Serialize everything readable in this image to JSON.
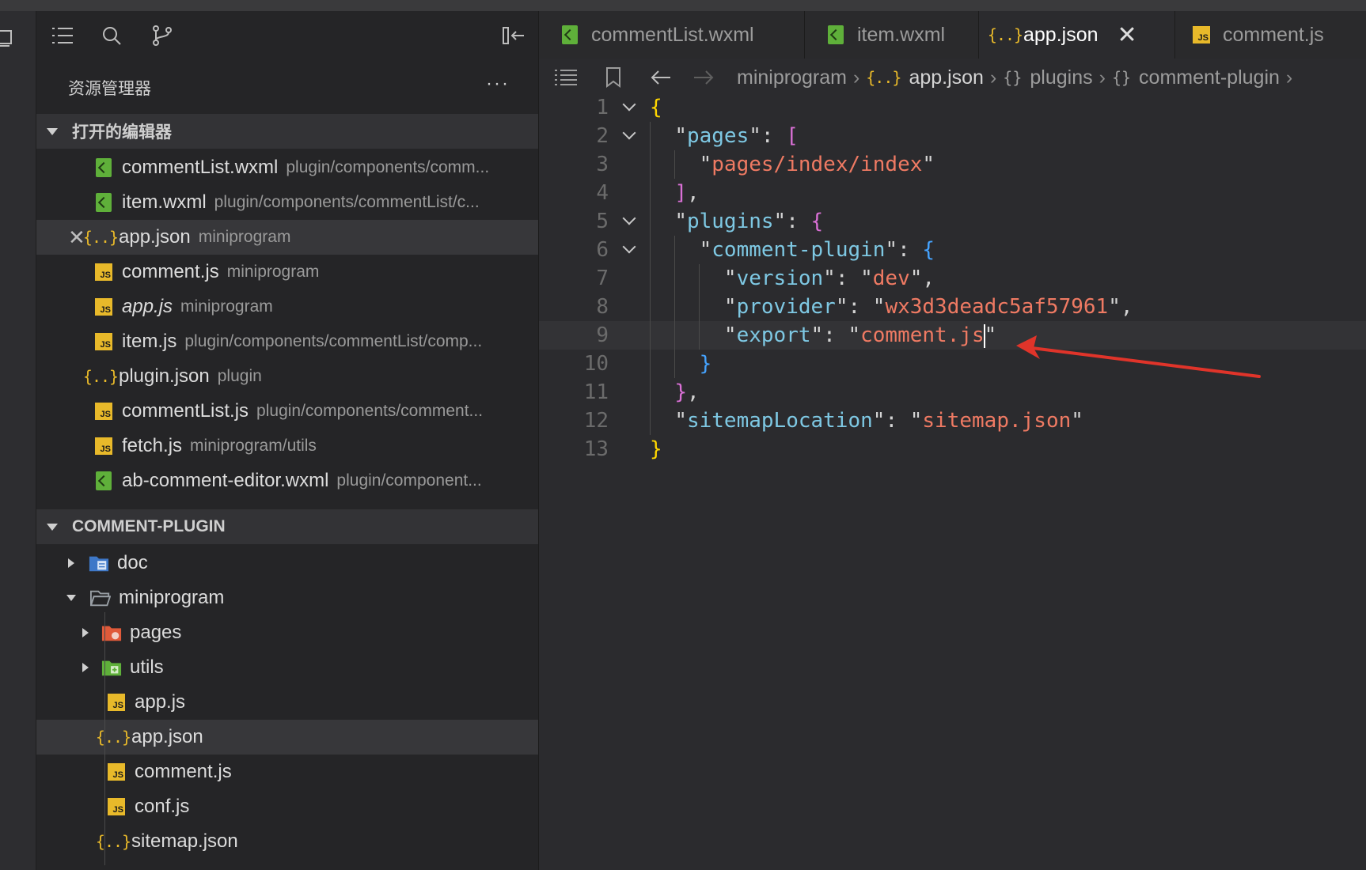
{
  "sidebar": {
    "title": "资源管理器",
    "more": "···",
    "open_editors": {
      "title": "打开的编辑器",
      "items": [
        {
          "name": "commentList.wxml",
          "path": "plugin/components/comm...",
          "icon": "wxml"
        },
        {
          "name": "item.wxml",
          "path": "plugin/components/commentList/c...",
          "icon": "wxml"
        },
        {
          "name": "app.json",
          "path": "miniprogram",
          "icon": "json"
        },
        {
          "name": "comment.js",
          "path": "miniprogram",
          "icon": "js"
        },
        {
          "name": "app.js",
          "path": "miniprogram",
          "icon": "js"
        },
        {
          "name": "item.js",
          "path": "plugin/components/commentList/comp...",
          "icon": "js"
        },
        {
          "name": "plugin.json",
          "path": "plugin",
          "icon": "json"
        },
        {
          "name": "commentList.js",
          "path": "plugin/components/comment...",
          "icon": "js"
        },
        {
          "name": "fetch.js",
          "path": "miniprogram/utils",
          "icon": "js"
        },
        {
          "name": "ab-comment-editor.wxml",
          "path": "plugin/component...",
          "icon": "wxml"
        }
      ]
    },
    "project": {
      "title": "COMMENT-PLUGIN",
      "tree": [
        {
          "name": "doc"
        },
        {
          "name": "miniprogram"
        },
        {
          "name": "pages"
        },
        {
          "name": "utils"
        },
        {
          "name": "app.js"
        },
        {
          "name": "app.json"
        },
        {
          "name": "comment.js"
        },
        {
          "name": "conf.js"
        },
        {
          "name": "sitemap.json"
        }
      ]
    }
  },
  "tabs": [
    {
      "label": "commentList.wxml",
      "icon": "wxml"
    },
    {
      "label": "item.wxml",
      "icon": "wxml"
    },
    {
      "label": "app.json",
      "icon": "json",
      "active": true,
      "close": "✕"
    },
    {
      "label": "comment.js",
      "icon": "js"
    }
  ],
  "breadcrumb": [
    "miniprogram",
    "app.json",
    "plugins",
    "comment-plugin"
  ],
  "editor": {
    "line_numbers": [
      "1",
      "2",
      "3",
      "4",
      "5",
      "6",
      "7",
      "8",
      "9",
      "10",
      "11",
      "12",
      "13"
    ],
    "lines": [
      "{",
      "  \"pages\": [",
      "    \"pages/index/index\"",
      "  ],",
      "  \"plugins\": {",
      "    \"comment-plugin\": {",
      "      \"version\": \"dev\",",
      "      \"provider\": \"wx3d3deadc5af57961\",",
      "      \"export\": \"comment.js\"",
      "    }",
      "  },",
      "  \"sitemapLocation\": \"sitemap.json\"",
      "}"
    ],
    "current_line": 9
  },
  "colors": {
    "key": "#7ec8e3",
    "string": "#ef7a63",
    "bracket_level1": "#ffd700",
    "bracket_level2": "#da70d6",
    "bracket_level3": "#45a3ff",
    "arrow": "#e0342a"
  }
}
